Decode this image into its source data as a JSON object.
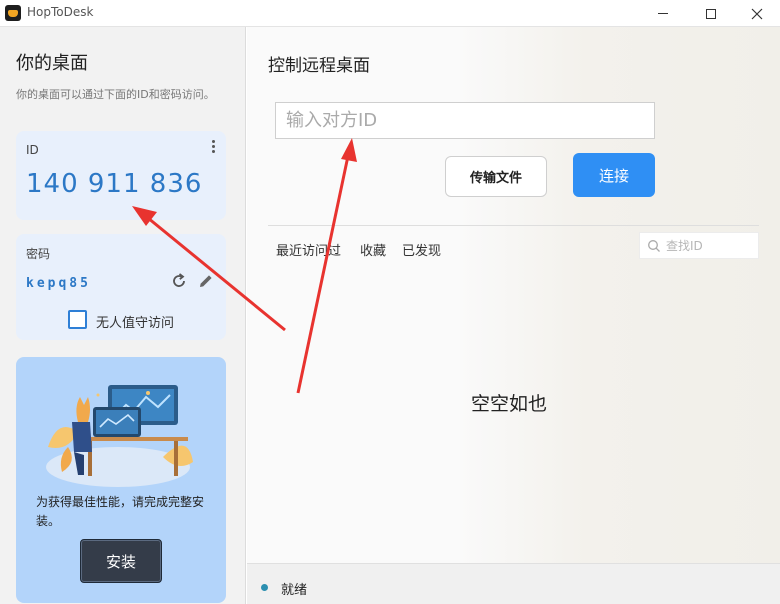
{
  "window": {
    "title": "HopToDesk"
  },
  "left_panel": {
    "title": "你的桌面",
    "description": "你的桌面可以通过下面的ID和密码访问。",
    "id_card": {
      "label": "ID",
      "value": "140 911 836"
    },
    "password_card": {
      "label": "密码",
      "value": "kepq85",
      "unattended_label": "无人值守访问",
      "unattended_checked": false
    },
    "install_card": {
      "message": "为获得最佳性能，请完成完整安装。",
      "button_label": "安装"
    }
  },
  "right_panel": {
    "title": "控制远程桌面",
    "id_input": {
      "placeholder": "输入对方ID",
      "value": ""
    },
    "transfer_button": "传输文件",
    "connect_button": "连接",
    "tabs": [
      "最近访问过",
      "收藏",
      "已发现"
    ],
    "search": {
      "placeholder": "查找ID",
      "value": ""
    },
    "empty_message": "空空如也"
  },
  "status_bar": {
    "text": "就绪"
  },
  "colors": {
    "accent": "#2f8ff4",
    "id_text": "#2c78c6",
    "card_bg": "#e8f0fc",
    "install_card_bg": "#b3d4fa",
    "install_button": "#343c49",
    "annotation_arrow": "#e8332f"
  },
  "icons": {
    "more": "kebab-menu-icon",
    "refresh": "refresh-icon",
    "edit": "pencil-icon",
    "search": "search-icon"
  }
}
